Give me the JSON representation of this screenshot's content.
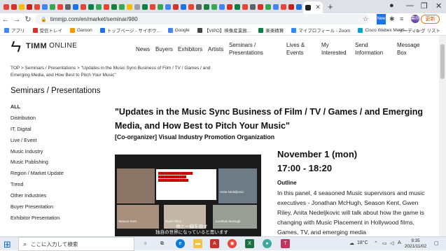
{
  "browser": {
    "url": "timmjp.com/en/market/seminar/980",
    "update_label": "更新",
    "avatar_label": "幕府",
    "bookmarks": [
      {
        "label": "アプリ",
        "color": "#4285f4"
      },
      {
        "label": "受信トレイ",
        "color": "#d93025"
      },
      {
        "label": "Garoon",
        "color": "#f29900"
      },
      {
        "label": "トップページ - サイボウ...",
        "color": "#1a73e8"
      },
      {
        "label": "Google",
        "color": "#4285f4"
      },
      {
        "label": "【VIPO】映像産業振...",
        "color": "#444444"
      },
      {
        "label": "楽楽精算",
        "color": "#0b8043"
      },
      {
        "label": "マイプロフィール - Zoom",
        "color": "#2d8cff"
      },
      {
        "label": "Cisco Webex Meeti...",
        "color": "#00a0d1"
      }
    ],
    "reading_list_label": "リーディング リスト"
  },
  "site": {
    "logo": {
      "mark": "ㄣ",
      "name": "TIMM",
      "suffix": "ONLINE"
    },
    "nav": [
      {
        "label": "News"
      },
      {
        "label": "Buyers"
      },
      {
        "label": "Exhibitors"
      },
      {
        "label": "Artists"
      },
      {
        "label": "Seminars / Presentations"
      },
      {
        "label": "Lives & Events"
      },
      {
        "label": "My Interested"
      },
      {
        "label": "Send Information"
      },
      {
        "label": "Message Box"
      }
    ],
    "breadcrumb": "TOP > Seminars / Presentations > \"Updates in the Music Sync Business of Film / TV / Games / and Emerging Media, and How Best to Pitch Your Music\"",
    "section_title": "Seminars / Presentations",
    "sidebar": [
      {
        "label": "ALL"
      },
      {
        "label": "Distribution"
      },
      {
        "label": "IT, Digital"
      },
      {
        "label": "Live / Event"
      },
      {
        "label": "Music Industry"
      },
      {
        "label": "Music Publishing"
      },
      {
        "label": "Region / Market Update"
      },
      {
        "label": "Trend"
      },
      {
        "label": "Other Industries"
      },
      {
        "label": "Buyer Presentation"
      },
      {
        "label": "Exhibitor Presentation"
      }
    ],
    "seminar": {
      "title": "\"Updates in the Music Sync Business of Film / TV / Games / and Emerging Media, and How Best to Pitch Your Music\"",
      "co_organizer": "[Co-organizer] Visual Industry Promotion Organization",
      "date": "November 1 (mon)",
      "time": "17:00 - 18:20",
      "outline_label": "Outline",
      "outline_text": "In this panel, 4 seasoned Music supervisors and music executives - Jonathan McHugh, Season Kent, Gwen Riley, Anita Nedeljkovic will talk about how the game is changing with Music Placement in Hollywood films, Games, TV, and emerging media",
      "video": {
        "speakers": [
          "Anita Nedeljkovic",
          "Season Kent",
          "Gwen Riley",
          "Jonathan McHugh"
        ],
        "subtitle": "他と一線を画す\n独自の世界になっていると思います"
      }
    }
  },
  "taskbar": {
    "search_placeholder": "ここに入力して検索",
    "weather": "18°C",
    "ime": "A",
    "time": "9:35",
    "date": "2021/11/02"
  }
}
